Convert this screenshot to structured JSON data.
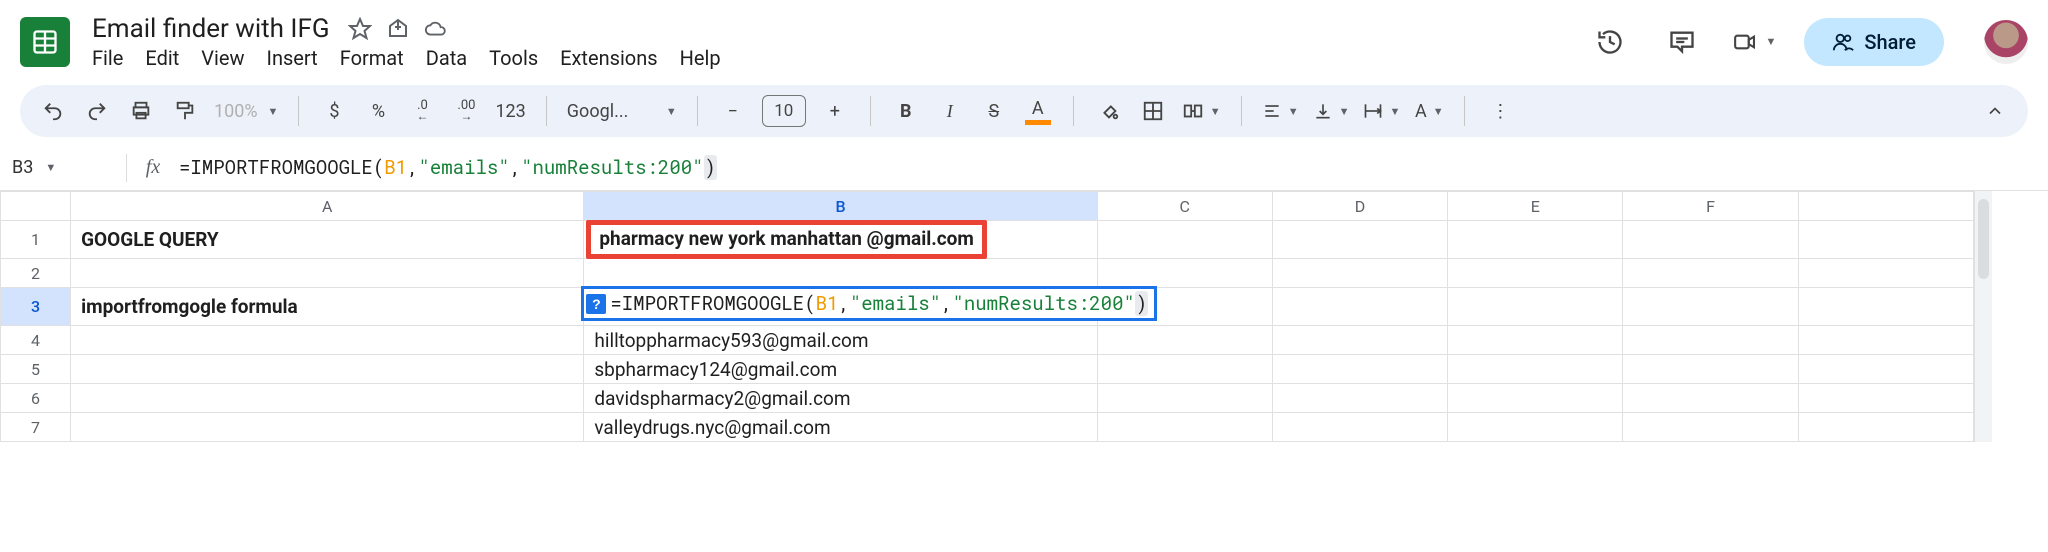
{
  "doc": {
    "title": "Email finder with IFG"
  },
  "menubar": {
    "file": "File",
    "edit": "Edit",
    "view": "View",
    "insert": "Insert",
    "format": "Format",
    "data": "Data",
    "tools": "Tools",
    "extensions": "Extensions",
    "help": "Help"
  },
  "share": {
    "label": "Share"
  },
  "toolbar": {
    "zoom": "100%",
    "currency": "$",
    "percent": "%",
    "dec_dec": ".0",
    "inc_dec": ".00",
    "numfmt": "123",
    "font": "Googl...",
    "fontsize": "10",
    "bold": "B",
    "italic": "I",
    "strike": "S",
    "textcolor": "A"
  },
  "namebox": {
    "value": "B3"
  },
  "formula": {
    "prefix": "=",
    "fn": "IMPORTFROMGOOGLE",
    "arg_ref": "B1",
    "arg1": "\"emails\"",
    "arg2": "\"numResults:200\"",
    "full_raw": "=IMPORTFROMGOOGLE(B1,\"emails\",\"numResults:200\")"
  },
  "columns": [
    "A",
    "B",
    "C",
    "D",
    "E",
    "F"
  ],
  "rows": [
    "1",
    "2",
    "3",
    "4",
    "5",
    "6",
    "7"
  ],
  "cells": {
    "A1": "GOOGLE QUERY",
    "B1": "pharmacy new york manhattan @gmail.com",
    "A3": "importfromgogle formula",
    "B3_prefix": "=",
    "B3_fn": "IMPORTFROMGOOGLE",
    "B3_ref": "B1",
    "B3_arg1": "\"emails\"",
    "B3_arg2": "\"numResults:200\"",
    "B4": "hilltoppharmacy593@gmail.com",
    "B5": "sbpharmacy124@gmail.com",
    "B6": "davidspharmacy2@gmail.com",
    "B7": "valleydrugs.nyc@gmail.com"
  },
  "icons": {
    "help_q": "?"
  }
}
